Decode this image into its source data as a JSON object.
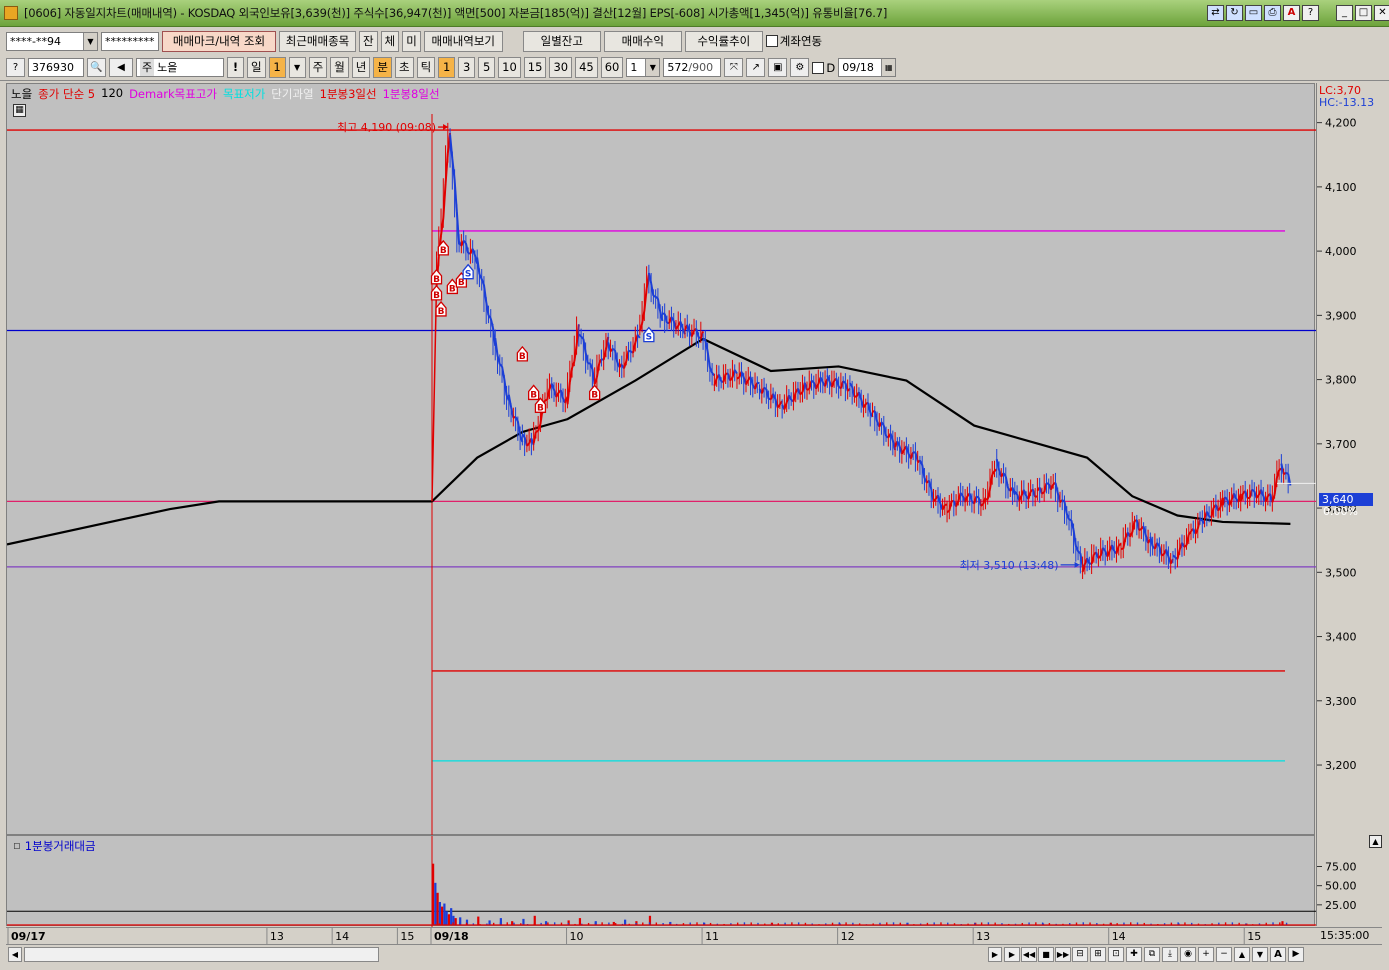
{
  "window": {
    "title": "[0606] 자동일지차트(매매내역) - KOSDAQ 외국인보유[3,639(천)] 주식수[36,947(천)] 액면[500] 자본금[185(억)] 결산[12월] EPS[-608] 시가총액[1,345(억)] 유통비율[76.7]"
  },
  "toolbar1": {
    "account": "****-**94",
    "password": "*********",
    "btn_markview": "매매마크/내역 조회",
    "btn_recent": "최근매매종목",
    "btn_jan": "잔",
    "btn_che": "체",
    "btn_mi": "미",
    "btn_history": "매매내역보기",
    "btn_daily": "일별잔고",
    "btn_profit": "매매수익",
    "btn_returns": "수익률추이",
    "link_label": "계좌연동"
  },
  "toolbar2": {
    "code": "376930",
    "stock_prefix": "주",
    "stock_name": "노을",
    "period_il": "일",
    "period_val": "1",
    "periods": [
      "주",
      "월",
      "년",
      "분",
      "초",
      "틱"
    ],
    "minute_opts": [
      "1",
      "3",
      "5",
      "10",
      "15",
      "30",
      "45",
      "60"
    ],
    "count_val": "1",
    "display_count": "572",
    "display_total": "/900",
    "d_label": "D",
    "date": "09/18"
  },
  "legend": {
    "name": "노을",
    "ma": "종가 단순 5",
    "ma2": "120",
    "demark_high": "Demark목표고가",
    "demark_low": "목표저가",
    "short_overheat": "단기과열",
    "line3": "1분봉3일선",
    "line8": "1분봉8일선"
  },
  "right_info": {
    "lc": "LC:3,70",
    "hc": "HC:-13.13",
    "price_box": "3,640",
    "pct": "0.00%"
  },
  "annotations": {
    "high": "최고 4,190 (09:08)",
    "low": "최저 3,510 (13:48)"
  },
  "volume": {
    "title": "1분봉거래대금",
    "ticks": [
      "75.00",
      "50.00",
      "25.00"
    ]
  },
  "bottom": {
    "time": "15:35:00"
  },
  "colors": {
    "up": "#e00000",
    "down": "#1c3fd6",
    "ma120": "#000000",
    "demark_high": "#e000e0",
    "demark_low": "#00e0e0",
    "line_blue": "#0000cc",
    "line_red": "#e00000",
    "line_purple": "#8040c0",
    "pink_line": "#e0206a"
  },
  "chart_data": {
    "type": "candlestick",
    "interval": "1분",
    "y_ticks": [
      4200,
      4100,
      4000,
      3900,
      3800,
      3700,
      3600,
      3500,
      3400,
      3300,
      3200
    ],
    "ylim": [
      3144,
      4215
    ],
    "x_labels": [
      {
        "label": "09/17",
        "session": 0,
        "hour": 9,
        "bold": true
      },
      {
        "label": "13",
        "session": 0,
        "hour": 13
      },
      {
        "label": "14",
        "session": 0,
        "hour": 14
      },
      {
        "label": "15",
        "session": 0,
        "hour": 15
      },
      {
        "label": "09/18",
        "session": 1,
        "hour": 9,
        "bold": true
      },
      {
        "label": "10",
        "session": 1,
        "hour": 10
      },
      {
        "label": "11",
        "session": 1,
        "hour": 11
      },
      {
        "label": "12",
        "session": 1,
        "hour": 12
      },
      {
        "label": "13",
        "session": 1,
        "hour": 13
      },
      {
        "label": "14",
        "session": 1,
        "hour": 14
      },
      {
        "label": "15",
        "session": 1,
        "hour": 15
      }
    ],
    "prev_close": 3612,
    "high": {
      "value": 4190,
      "time": "09:08"
    },
    "low": {
      "value": 3510,
      "time": "13:48"
    },
    "last": 3640,
    "hlines": [
      {
        "name": "최고",
        "value": 4190,
        "color": "#e00000",
        "from": "09/17"
      },
      {
        "name": "Demark목표고가",
        "value": 4033,
        "color": "#e000e0",
        "from": "09/18"
      },
      {
        "name": "blue-line",
        "value": 3878,
        "color": "#0000cc",
        "from": "09/17"
      },
      {
        "name": "기준가",
        "value": 3612,
        "color": "#e0206a",
        "from": "09/17"
      },
      {
        "name": "최저",
        "value": 3510,
        "color": "#8040c0",
        "from": "09/17"
      },
      {
        "name": "red-low",
        "value": 3348,
        "color": "#e00000",
        "from": "09/18"
      },
      {
        "name": "목표저가",
        "value": 3208,
        "color": "#00e0e0",
        "from": "09/18"
      }
    ],
    "price_path": [
      [
        "09:00",
        3612
      ],
      [
        "09:02",
        3950
      ],
      [
        "09:05",
        4060
      ],
      [
        "09:08",
        4190
      ],
      [
        "09:12",
        4020
      ],
      [
        "09:20",
        3990
      ],
      [
        "09:28",
        3860
      ],
      [
        "09:34",
        3770
      ],
      [
        "09:40",
        3710
      ],
      [
        "09:45",
        3700
      ],
      [
        "09:52",
        3790
      ],
      [
        "10:00",
        3770
      ],
      [
        "10:05",
        3880
      ],
      [
        "10:12",
        3800
      ],
      [
        "10:18",
        3860
      ],
      [
        "10:24",
        3820
      ],
      [
        "10:32",
        3870
      ],
      [
        "10:36",
        3960
      ],
      [
        "10:42",
        3900
      ],
      [
        "10:52",
        3880
      ],
      [
        "11:00",
        3870
      ],
      [
        "11:05",
        3800
      ],
      [
        "11:15",
        3810
      ],
      [
        "11:25",
        3790
      ],
      [
        "11:35",
        3760
      ],
      [
        "11:45",
        3790
      ],
      [
        "11:55",
        3800
      ],
      [
        "12:05",
        3790
      ],
      [
        "12:15",
        3750
      ],
      [
        "12:25",
        3700
      ],
      [
        "12:35",
        3680
      ],
      [
        "12:42",
        3620
      ],
      [
        "12:48",
        3600
      ],
      [
        "12:55",
        3620
      ],
      [
        "13:05",
        3610
      ],
      [
        "13:10",
        3670
      ],
      [
        "13:18",
        3620
      ],
      [
        "13:28",
        3625
      ],
      [
        "13:35",
        3640
      ],
      [
        "13:42",
        3590
      ],
      [
        "13:48",
        3510
      ],
      [
        "13:55",
        3530
      ],
      [
        "14:05",
        3540
      ],
      [
        "14:12",
        3580
      ],
      [
        "14:18",
        3550
      ],
      [
        "14:28",
        3520
      ],
      [
        "14:36",
        3560
      ],
      [
        "14:42",
        3585
      ],
      [
        "14:50",
        3610
      ],
      [
        "14:58",
        3620
      ],
      [
        "15:05",
        3625
      ],
      [
        "15:12",
        3615
      ],
      [
        "15:16",
        3670
      ],
      [
        "15:20",
        3640
      ]
    ],
    "ma120": [
      [
        "09/17 09:00",
        3545
      ],
      [
        "09/17 11:30",
        3600
      ],
      [
        "09/17 12:15",
        3612
      ],
      [
        "09/17 15:30",
        3612
      ],
      [
        "09:00",
        3612
      ],
      [
        "09:20",
        3680
      ],
      [
        "09:40",
        3720
      ],
      [
        "10:00",
        3740
      ],
      [
        "10:30",
        3800
      ],
      [
        "11:00",
        3865
      ],
      [
        "11:30",
        3815
      ],
      [
        "12:00",
        3822
      ],
      [
        "12:30",
        3800
      ],
      [
        "13:00",
        3730
      ],
      [
        "13:30",
        3700
      ],
      [
        "13:50",
        3680
      ],
      [
        "14:10",
        3620
      ],
      [
        "14:30",
        3590
      ],
      [
        "14:50",
        3580
      ],
      [
        "15:20",
        3577
      ]
    ],
    "signals": [
      {
        "type": "B",
        "time": "09:02",
        "value": 3960
      },
      {
        "type": "B",
        "time": "09:02",
        "value": 3935
      },
      {
        "type": "B",
        "time": "09:05",
        "value": 4005
      },
      {
        "type": "B",
        "time": "09:04",
        "value": 3910
      },
      {
        "type": "B",
        "time": "09:09",
        "value": 3945
      },
      {
        "type": "B",
        "time": "09:13",
        "value": 3955
      },
      {
        "type": "S",
        "time": "09:16",
        "value": 3968
      },
      {
        "type": "B",
        "time": "09:40",
        "value": 3840
      },
      {
        "type": "B",
        "time": "09:45",
        "value": 3780
      },
      {
        "type": "B",
        "time": "09:48",
        "value": 3760
      },
      {
        "type": "B",
        "time": "10:12",
        "value": 3780
      },
      {
        "type": "S",
        "time": "10:36",
        "value": 3870
      }
    ],
    "volume_series": {
      "name": "1분봉거래대금",
      "ylim": [
        0,
        90
      ],
      "bars": [
        [
          "09:00",
          80,
          "up"
        ],
        [
          "09:01",
          55,
          "down"
        ],
        [
          "09:02",
          42,
          "up"
        ],
        [
          "09:03",
          30,
          "down"
        ],
        [
          "09:04",
          24,
          "up"
        ],
        [
          "09:05",
          28,
          "down"
        ],
        [
          "09:06",
          18,
          "down"
        ],
        [
          "09:07",
          14,
          "up"
        ],
        [
          "09:08",
          22,
          "down"
        ],
        [
          "09:09",
          12,
          "down"
        ],
        [
          "09:10",
          9,
          "up"
        ],
        [
          "09:12",
          10,
          "down"
        ],
        [
          "09:15",
          7,
          "down"
        ],
        [
          "09:20",
          11,
          "up"
        ],
        [
          "09:25",
          6,
          "down"
        ],
        [
          "09:30",
          9,
          "down"
        ],
        [
          "09:35",
          5,
          "up"
        ],
        [
          "09:40",
          8,
          "down"
        ],
        [
          "09:45",
          12,
          "up"
        ],
        [
          "09:50",
          5,
          "down"
        ],
        [
          "10:00",
          6,
          "up"
        ],
        [
          "10:05",
          9,
          "up"
        ],
        [
          "10:12",
          5,
          "down"
        ],
        [
          "10:20",
          4,
          "up"
        ],
        [
          "10:25",
          7,
          "down"
        ],
        [
          "10:30",
          5,
          "up"
        ],
        [
          "10:36",
          12,
          "up"
        ],
        [
          "10:45",
          4,
          "down"
        ],
        [
          "11:00",
          3,
          "down"
        ],
        [
          "11:30",
          3,
          "up"
        ],
        [
          "12:00",
          2,
          "down"
        ],
        [
          "12:30",
          3,
          "down"
        ],
        [
          "13:00",
          3,
          "up"
        ],
        [
          "13:30",
          2,
          "down"
        ],
        [
          "14:00",
          3,
          "up"
        ],
        [
          "14:30",
          2,
          "down"
        ],
        [
          "15:00",
          2,
          "up"
        ],
        [
          "15:16",
          5,
          "up"
        ]
      ]
    }
  }
}
